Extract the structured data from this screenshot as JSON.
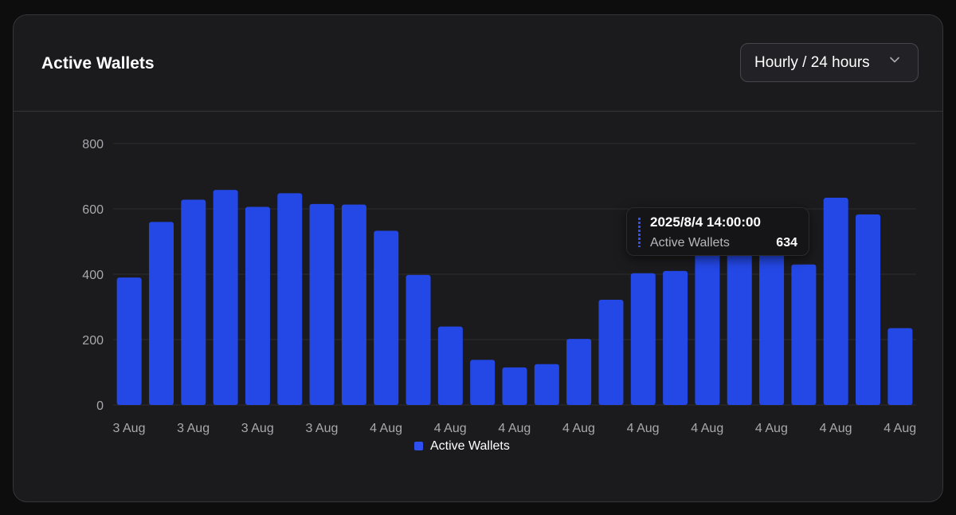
{
  "card": {
    "title": "Active Wallets",
    "range_selector": {
      "label": "Hourly / 24 hours"
    }
  },
  "tooltip": {
    "time": "2025/8/4 14:00:00",
    "series": "Active Wallets",
    "value": "634"
  },
  "legend": {
    "label": "Active Wallets"
  },
  "colors": {
    "bar": "#2448e6",
    "grid": "#2c2c30",
    "axis_text": "#a8a8ae",
    "card_bg": "#1b1b1d"
  },
  "chart_data": {
    "type": "bar",
    "series": [
      {
        "name": "Active Wallets",
        "values": [
          390,
          560,
          628,
          658,
          606,
          648,
          615,
          613,
          533,
          398,
          240,
          138,
          115,
          125,
          202,
          322,
          403,
          410,
          585,
          500,
          578,
          430,
          634,
          583,
          235
        ]
      }
    ],
    "x_tick_labels": [
      "3 Aug",
      "3 Aug",
      "3 Aug",
      "3 Aug",
      "4 Aug",
      "4 Aug",
      "4 Aug",
      "4 Aug",
      "4 Aug",
      "4 Aug",
      "4 Aug",
      "4 Aug",
      "4 Aug"
    ],
    "y_ticks": [
      0,
      200,
      400,
      600,
      800
    ],
    "ylim": [
      0,
      800
    ],
    "grid": true,
    "legend_position": "bottom"
  }
}
